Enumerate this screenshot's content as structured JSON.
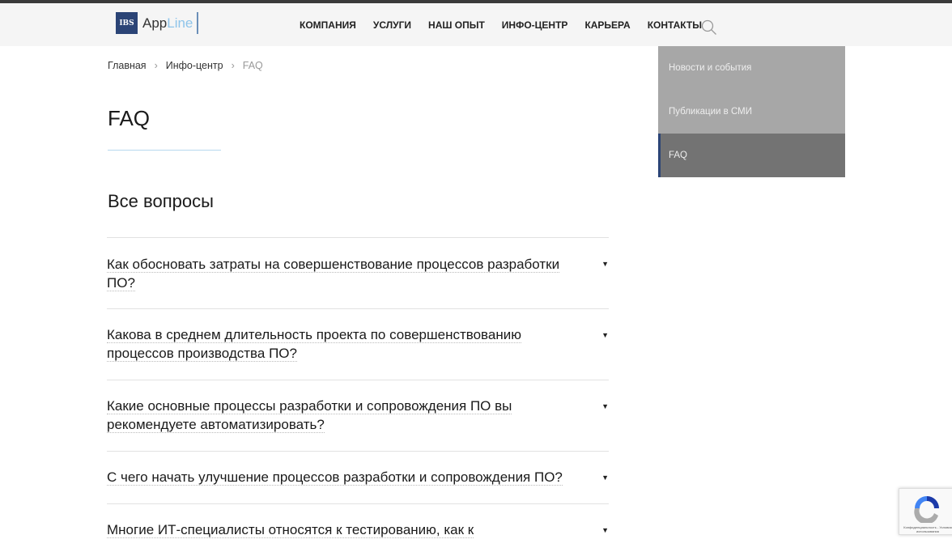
{
  "header": {
    "logo_mark": "IBS",
    "logo_text_a": "App",
    "logo_text_b": "Line",
    "nav": [
      "КОМПАНИЯ",
      "УСЛУГИ",
      "НАШ ОПЫТ",
      "ИНФО-ЦЕНТР",
      "КАРЬЕРА",
      "КОНТАКТЫ"
    ]
  },
  "breadcrumbs": [
    "Главная",
    "Инфо-центр",
    "FAQ"
  ],
  "breadcrumb_sep": "›",
  "title": "FAQ",
  "section_title": "Все вопросы",
  "faq": [
    "Как обосновать затраты на совершенствование процессов разработки ПО?",
    "Какова в среднем длительность проекта по совершенствованию процессов производства ПО?",
    "Какие основные процессы разработки и сопровождения ПО вы рекомендуете автоматизировать?",
    "С чего начать улучшение процессов разработки и сопровождения ПО?",
    "Многие ИТ-специалисты относятся к тестированию, как к"
  ],
  "sidebar": [
    "Новости и события",
    "Публикации в СМИ",
    "FAQ"
  ],
  "recaptcha": {
    "text": "Конфиденциальность - Условия использования"
  }
}
